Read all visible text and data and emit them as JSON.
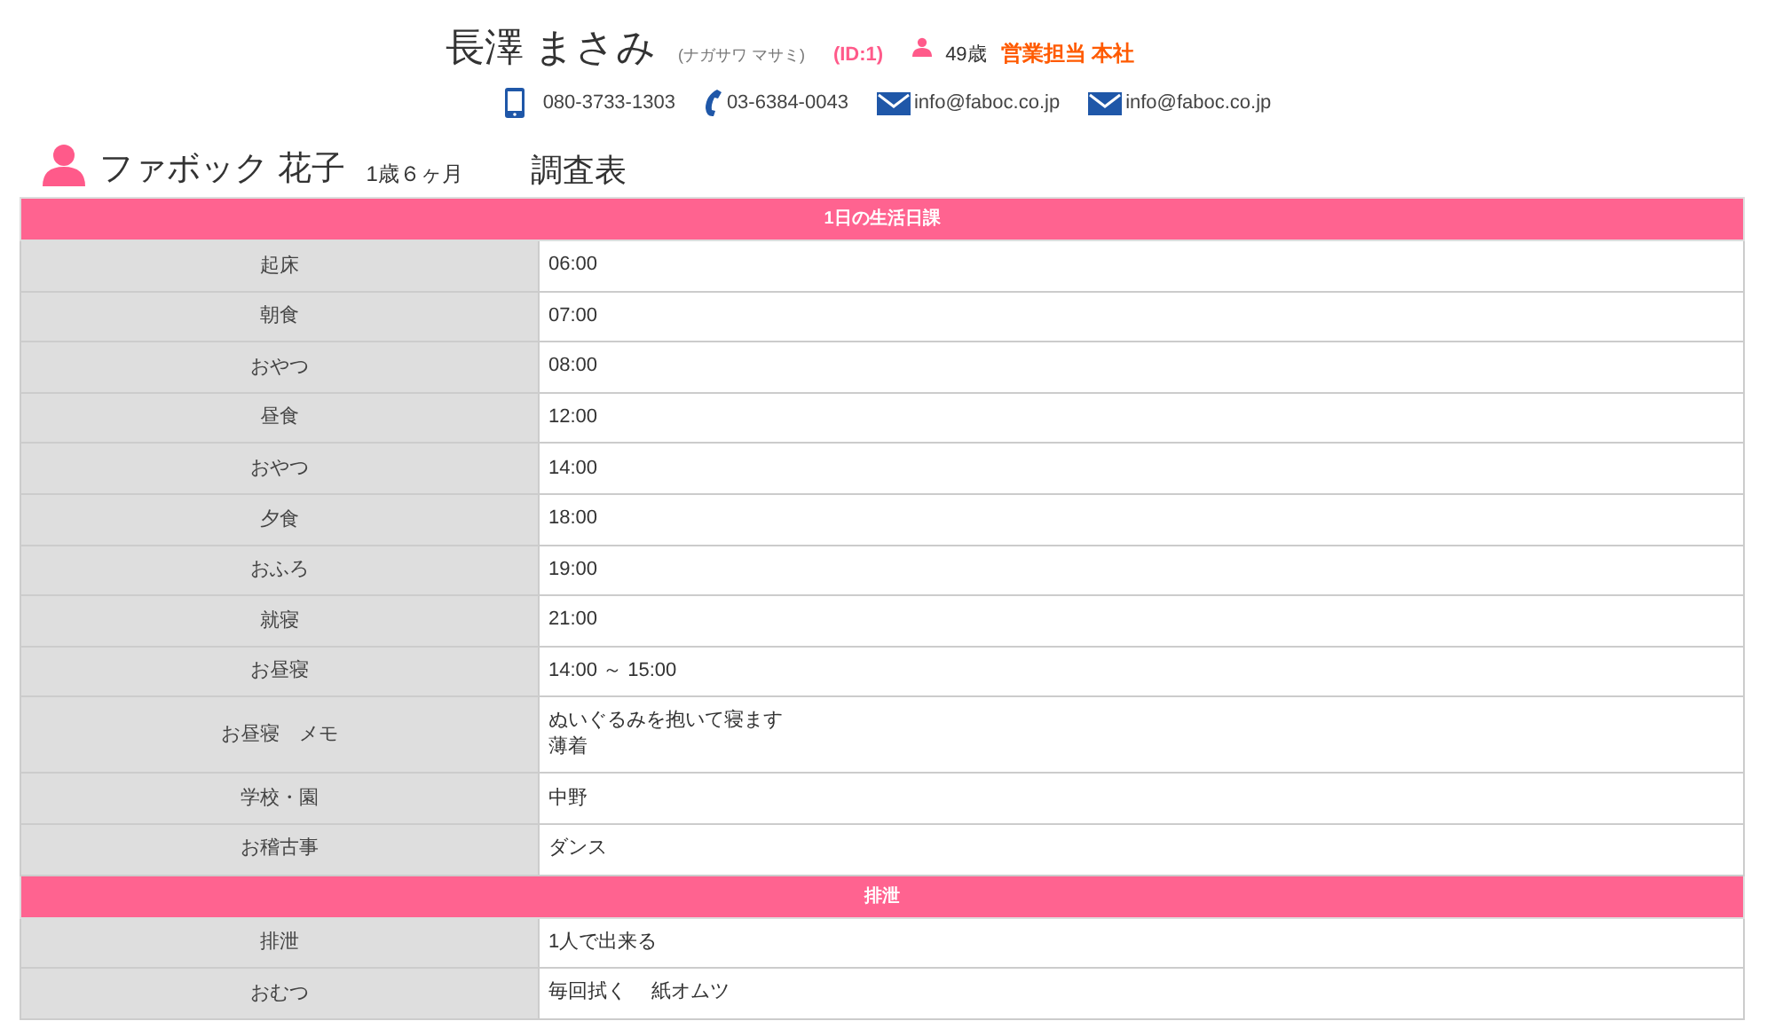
{
  "staff": {
    "name": "長澤 まさみ",
    "kana": "(ナガサワ マサミ)",
    "id": "(ID:1)",
    "age": "49歳",
    "role": "営業担当 本社"
  },
  "contacts": [
    {
      "kind": "mobile",
      "text": "080-3733-1303"
    },
    {
      "kind": "phone",
      "text": "03-6384-0043"
    },
    {
      "kind": "mail",
      "text": "info@faboc.co.jp"
    },
    {
      "kind": "mail",
      "text": "info@faboc.co.jp"
    }
  ],
  "child": {
    "name": "ファボック 花子",
    "age": "1歳６ヶ月",
    "title": "調査表"
  },
  "sections": [
    {
      "title": "1日の生活日課",
      "rows": [
        {
          "label": "起床",
          "value": [
            "06:00"
          ]
        },
        {
          "label": "朝食",
          "value": [
            "07:00"
          ]
        },
        {
          "label": "おやつ",
          "value": [
            "08:00"
          ]
        },
        {
          "label": "昼食",
          "value": [
            "12:00"
          ]
        },
        {
          "label": "おやつ",
          "value": [
            "14:00"
          ]
        },
        {
          "label": "夕食",
          "value": [
            "18:00"
          ]
        },
        {
          "label": "おふろ",
          "value": [
            "19:00"
          ]
        },
        {
          "label": "就寝",
          "value": [
            "21:00"
          ]
        },
        {
          "label": "お昼寝",
          "value": [
            "14:00 ～ 15:00"
          ]
        },
        {
          "label": "お昼寝　メモ",
          "value": [
            "ぬいぐるみを抱いて寝ます",
            "薄着"
          ]
        },
        {
          "label": "学校・園",
          "value": [
            "中野"
          ]
        },
        {
          "label": "お稽古事",
          "value": [
            "ダンス"
          ]
        }
      ]
    },
    {
      "title": "排泄",
      "rows": [
        {
          "label": "排泄",
          "value": [
            "1人で出来る"
          ]
        },
        {
          "label": "おむつ",
          "value": [
            "毎回拭く　 紙オムツ"
          ]
        }
      ]
    }
  ]
}
